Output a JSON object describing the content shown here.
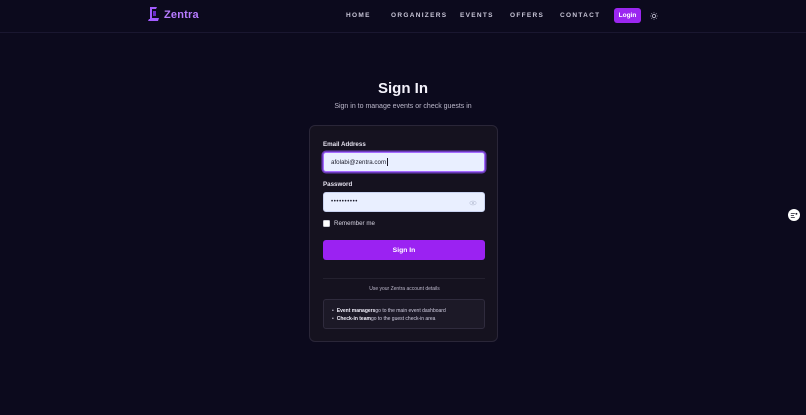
{
  "brand": {
    "name": "Zentra",
    "accent": "#b77bff"
  },
  "nav": {
    "items": [
      {
        "label": "HOME"
      },
      {
        "label": "ORGANIZERS"
      },
      {
        "label": "EVENTS"
      },
      {
        "label": "OFFERS"
      },
      {
        "label": "CONTACT"
      }
    ],
    "login_label": "Login",
    "theme_icon": "sun-icon"
  },
  "page": {
    "title": "Sign In",
    "subtitle": "Sign in to manage events or check guests in"
  },
  "form": {
    "email_label": "Email Address",
    "email_value": "afolabi@zentra.com",
    "password_label": "Password",
    "password_mask": "••••••••••",
    "remember_label": "Remember me",
    "remember_checked": false,
    "submit_label": "Sign In"
  },
  "help": {
    "hint": "Use your Zentra account details",
    "items": [
      {
        "role": "Event managers",
        "text": "go to the main event dashboard"
      },
      {
        "role": "Check-in team",
        "text": "go to the guest check-in area"
      }
    ]
  },
  "colors": {
    "background": "#0c0a1d",
    "primary": "#9b22f2",
    "card": "#15121f",
    "input": "#e9efff"
  }
}
